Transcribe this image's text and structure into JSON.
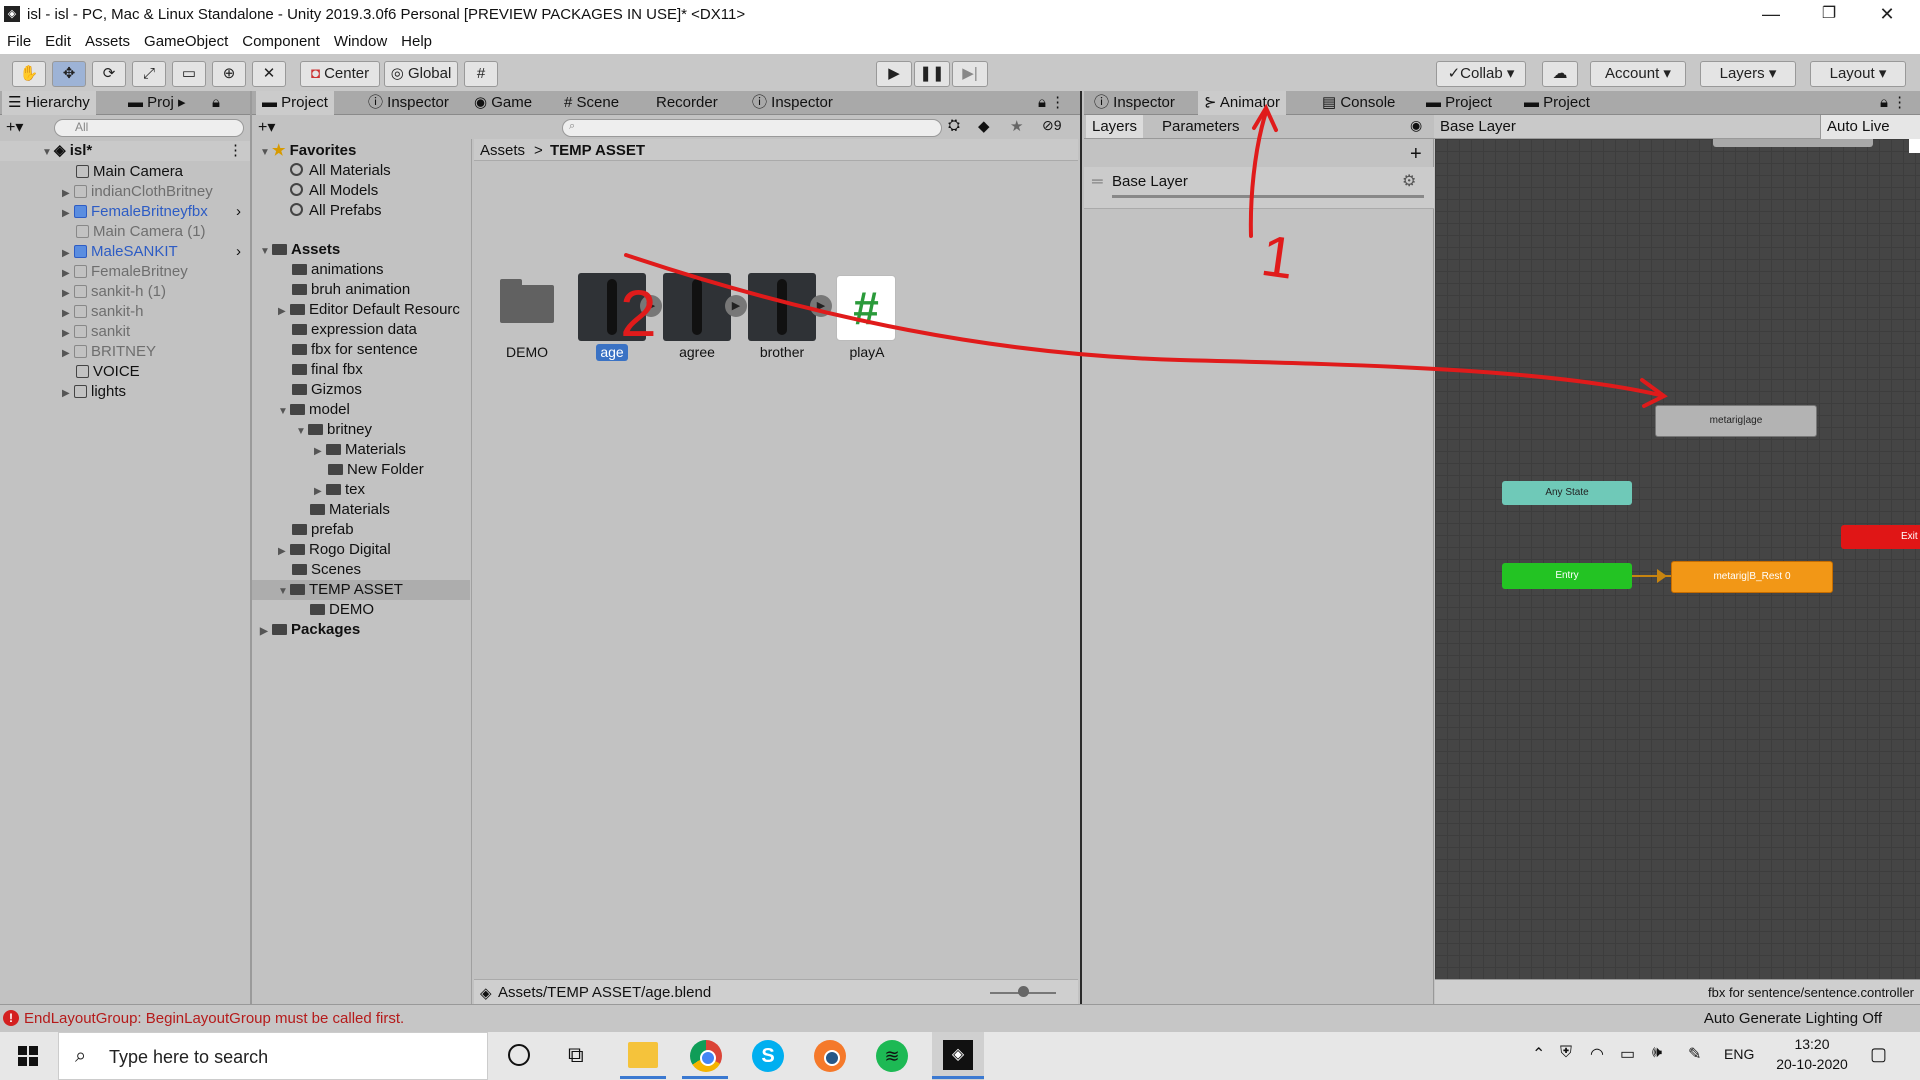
{
  "window": {
    "title": "isl - isl - PC, Mac & Linux Standalone - Unity 2019.3.0f6 Personal [PREVIEW PACKAGES IN USE]* <DX11>",
    "minimize": "—",
    "maximize": "❐",
    "close": "✕"
  },
  "menu": [
    "File",
    "Edit",
    "Assets",
    "GameObject",
    "Component",
    "Window",
    "Help"
  ],
  "toolbar": {
    "center": "Center",
    "global": "Global",
    "collab": "Collab",
    "account": "Account",
    "layers": "Layers",
    "layout": "Layout"
  },
  "hierarchy": {
    "tabs": [
      "Hierarchy",
      "Proj"
    ],
    "search_placeholder": "All",
    "scene": "isl*",
    "items": [
      "Main Camera",
      "indianClothBritney",
      "FemaleBritneyfbx",
      "Main Camera (1)",
      "MaleSANKIT",
      "FemaleBritney",
      "sankit-h (1)",
      "sankit-h",
      "sankit",
      "BRITNEY",
      "VOICE",
      "lights"
    ]
  },
  "project": {
    "tabs": [
      "Project",
      "Inspector",
      "Game",
      "Scene",
      "Recorder",
      "Inspector"
    ],
    "hidden_count": "9",
    "favorites": {
      "label": "Favorites",
      "items": [
        "All Materials",
        "All Models",
        "All Prefabs"
      ]
    },
    "assets": {
      "label": "Assets",
      "items": [
        "animations",
        "bruh animation",
        "Editor Default Resourc",
        "expression data",
        "fbx for sentence",
        "final fbx",
        "Gizmos",
        "model",
        "britney",
        "Materials",
        "New Folder",
        "tex",
        "Materials",
        "prefab",
        "Rogo Digital",
        "Scenes",
        "TEMP ASSET",
        "DEMO"
      ]
    },
    "packages": "Packages",
    "breadcrumb": {
      "root": "Assets",
      "sep": ">",
      "current": "TEMP ASSET"
    },
    "grid": [
      "DEMO",
      "age",
      "agree",
      "brother",
      "playA"
    ],
    "script_symbol": "#",
    "status_path": "Assets/TEMP ASSET/age.blend"
  },
  "animator": {
    "tabs": [
      "Inspector",
      "Animator",
      "Console",
      "Project",
      "Project"
    ],
    "subtabs": [
      "Layers",
      "Parameters"
    ],
    "breadcrumb": "Base Layer",
    "live_link": "Auto Live Link",
    "layer_name": "Base Layer",
    "nodes": {
      "age": "metarig|age",
      "any": "Any State",
      "exit": "Exit",
      "entry": "Entry",
      "rest": "metarig|B_Rest 0"
    },
    "controller_path": "fbx for sentence/sentence.controller"
  },
  "annotations": {
    "one": "1",
    "two": "2"
  },
  "console_error": "EndLayoutGroup: BeginLayoutGroup must be called first.",
  "lighting_status": "Auto Generate Lighting Off",
  "taskbar": {
    "search_placeholder": "Type here to search",
    "lang": "ENG",
    "time": "13:20",
    "date": "20-10-2020"
  },
  "colors": {
    "any_state": "#6fc9b8",
    "entry": "#23c323",
    "exit": "#e01616",
    "default_state": "#f29716",
    "selection": "#3a72c4",
    "annotation": "#e01b1b"
  }
}
